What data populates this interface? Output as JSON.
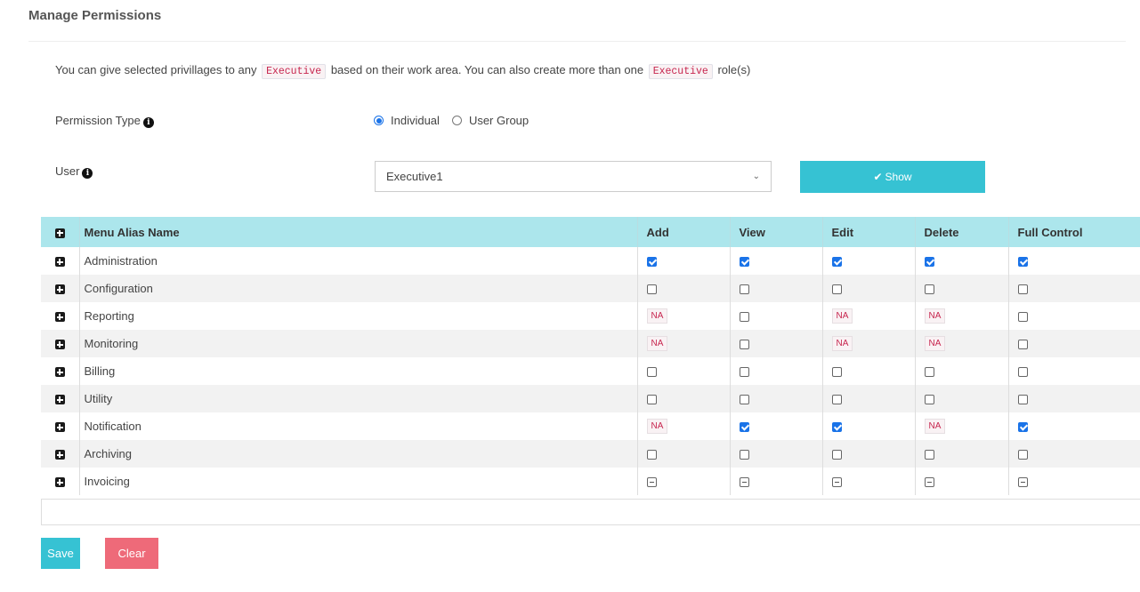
{
  "page": {
    "title": "Manage Permissions"
  },
  "intro": {
    "part1": "You can give selected privillages to any",
    "role1": "Executive",
    "part2": "based on their work area. You can also create more than one",
    "role2": "Executive",
    "part3": "role(s)"
  },
  "permission_type": {
    "label": "Permission Type",
    "options": [
      {
        "label": "Individual",
        "selected": true
      },
      {
        "label": "User Group",
        "selected": false
      }
    ]
  },
  "user": {
    "label": "User",
    "selected_value": "Executive1"
  },
  "show_button": {
    "label": "Show"
  },
  "table": {
    "headers": {
      "name": "Menu Alias Name",
      "add": "Add",
      "view": "View",
      "edit": "Edit",
      "delete": "Delete",
      "full": "Full Control"
    },
    "rows": [
      {
        "name": "Administration",
        "add": "checked",
        "view": "checked",
        "edit": "checked",
        "delete": "checked",
        "full": "checked"
      },
      {
        "name": "Configuration",
        "add": "unchecked",
        "view": "unchecked",
        "edit": "unchecked",
        "delete": "unchecked",
        "full": "unchecked"
      },
      {
        "name": "Reporting",
        "add": "NA",
        "view": "unchecked",
        "edit": "NA",
        "delete": "NA",
        "full": "unchecked"
      },
      {
        "name": "Monitoring",
        "add": "NA",
        "view": "unchecked",
        "edit": "NA",
        "delete": "NA",
        "full": "unchecked"
      },
      {
        "name": "Billing",
        "add": "unchecked",
        "view": "unchecked",
        "edit": "unchecked",
        "delete": "unchecked",
        "full": "unchecked"
      },
      {
        "name": "Utility",
        "add": "unchecked",
        "view": "unchecked",
        "edit": "unchecked",
        "delete": "unchecked",
        "full": "unchecked"
      },
      {
        "name": "Notification",
        "add": "NA",
        "view": "checked",
        "edit": "checked",
        "delete": "NA",
        "full": "checked"
      },
      {
        "name": "Archiving",
        "add": "unchecked",
        "view": "unchecked",
        "edit": "unchecked",
        "delete": "unchecked",
        "full": "unchecked"
      },
      {
        "name": "Invoicing",
        "add": "indeterminate",
        "view": "indeterminate",
        "edit": "indeterminate",
        "delete": "indeterminate",
        "full": "indeterminate"
      }
    ]
  },
  "actions": {
    "save": "Save",
    "clear": "Clear"
  },
  "colors": {
    "accent": "#36c2d3",
    "danger": "#ee6a79",
    "header_bg": "#ace6ec",
    "checkbox": "#1a73e8",
    "code_text": "#c7254e"
  }
}
